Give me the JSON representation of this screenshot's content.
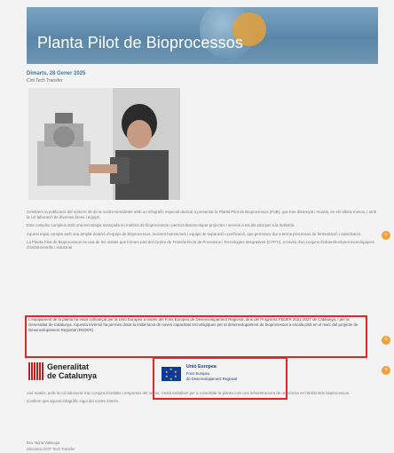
{
  "header": {
    "title": "Planta Pilot de Bioprocessos"
  },
  "post": {
    "date": "Dimarts, 28 Gener 2025",
    "author": "Ciot Tech Transfer",
    "paragraphs": [
      "Celebrem la publicació del número 35 de la nostra Newsletter amb un infogràfic especial dedicat a presentar la Planta Pilot de Bioprocessos (PoB), que han dissenyat i muntat, en els últims mesos, i amb la col·laboració de diverses àrees i equips.",
      "Este complex compleix amb una tecnologia avançada en matèria de bioprocessos i permet desenvolupar projectes i serveis a escala pilot per a la indústria.",
      "Aquest espai compta amb una àmplia dotació d'equips de bioprocessos, incloent bioreactors i equips de separació i purificació, que permeten dur a terme processos de fermentació i valorització.",
      "La Planta Pilot de Bioprocessos és una de les unitats que formen part del Centre de Transferència de Processos i Tecnologies Integratives (CTPTI), a través d'un conjunt d'infraestructures tecnològiques d'àmbit científic i industrial."
    ],
    "highlight": "L'equipament de la planta ha estat cofinançat per la Unió Europea a través del Fons Europeu de Desenvolupament Regional, dins del Programa FEDER 2021-2027 de Catalunya, i per la Generalitat de Catalunya. Aquesta inversió ha permès dotar la instal·lació de noves capacitats tecnològiques per al desenvolupament de bioprocessos a escala pilot en el marc del projecte de Desenvolupament Regional (FEDER).",
    "after_paragraphs": [
      "Així mateix, amb la col·laboració d'un conjunt d'entitats i empreses del sector, s'està treballant per a consolidar la planta com una infraestructura de referència en l'àmbit dels bioprocessos.",
      "Confiem que aquest infogràfic sigui del vostre interès."
    ],
    "signature_name": "Dra. Núria Vallmajor",
    "signature_role": "Directora CIOT Tech Transfer"
  },
  "logos": {
    "gencat_line1": "Generalitat",
    "gencat_line2": "de Catalunya",
    "eu_line1": "Unió Europea",
    "eu_line2": "Fons Europeu",
    "eu_line3": "de Desenvolupament Regional"
  },
  "side_buttons": [
    "+",
    "+",
    "+"
  ]
}
